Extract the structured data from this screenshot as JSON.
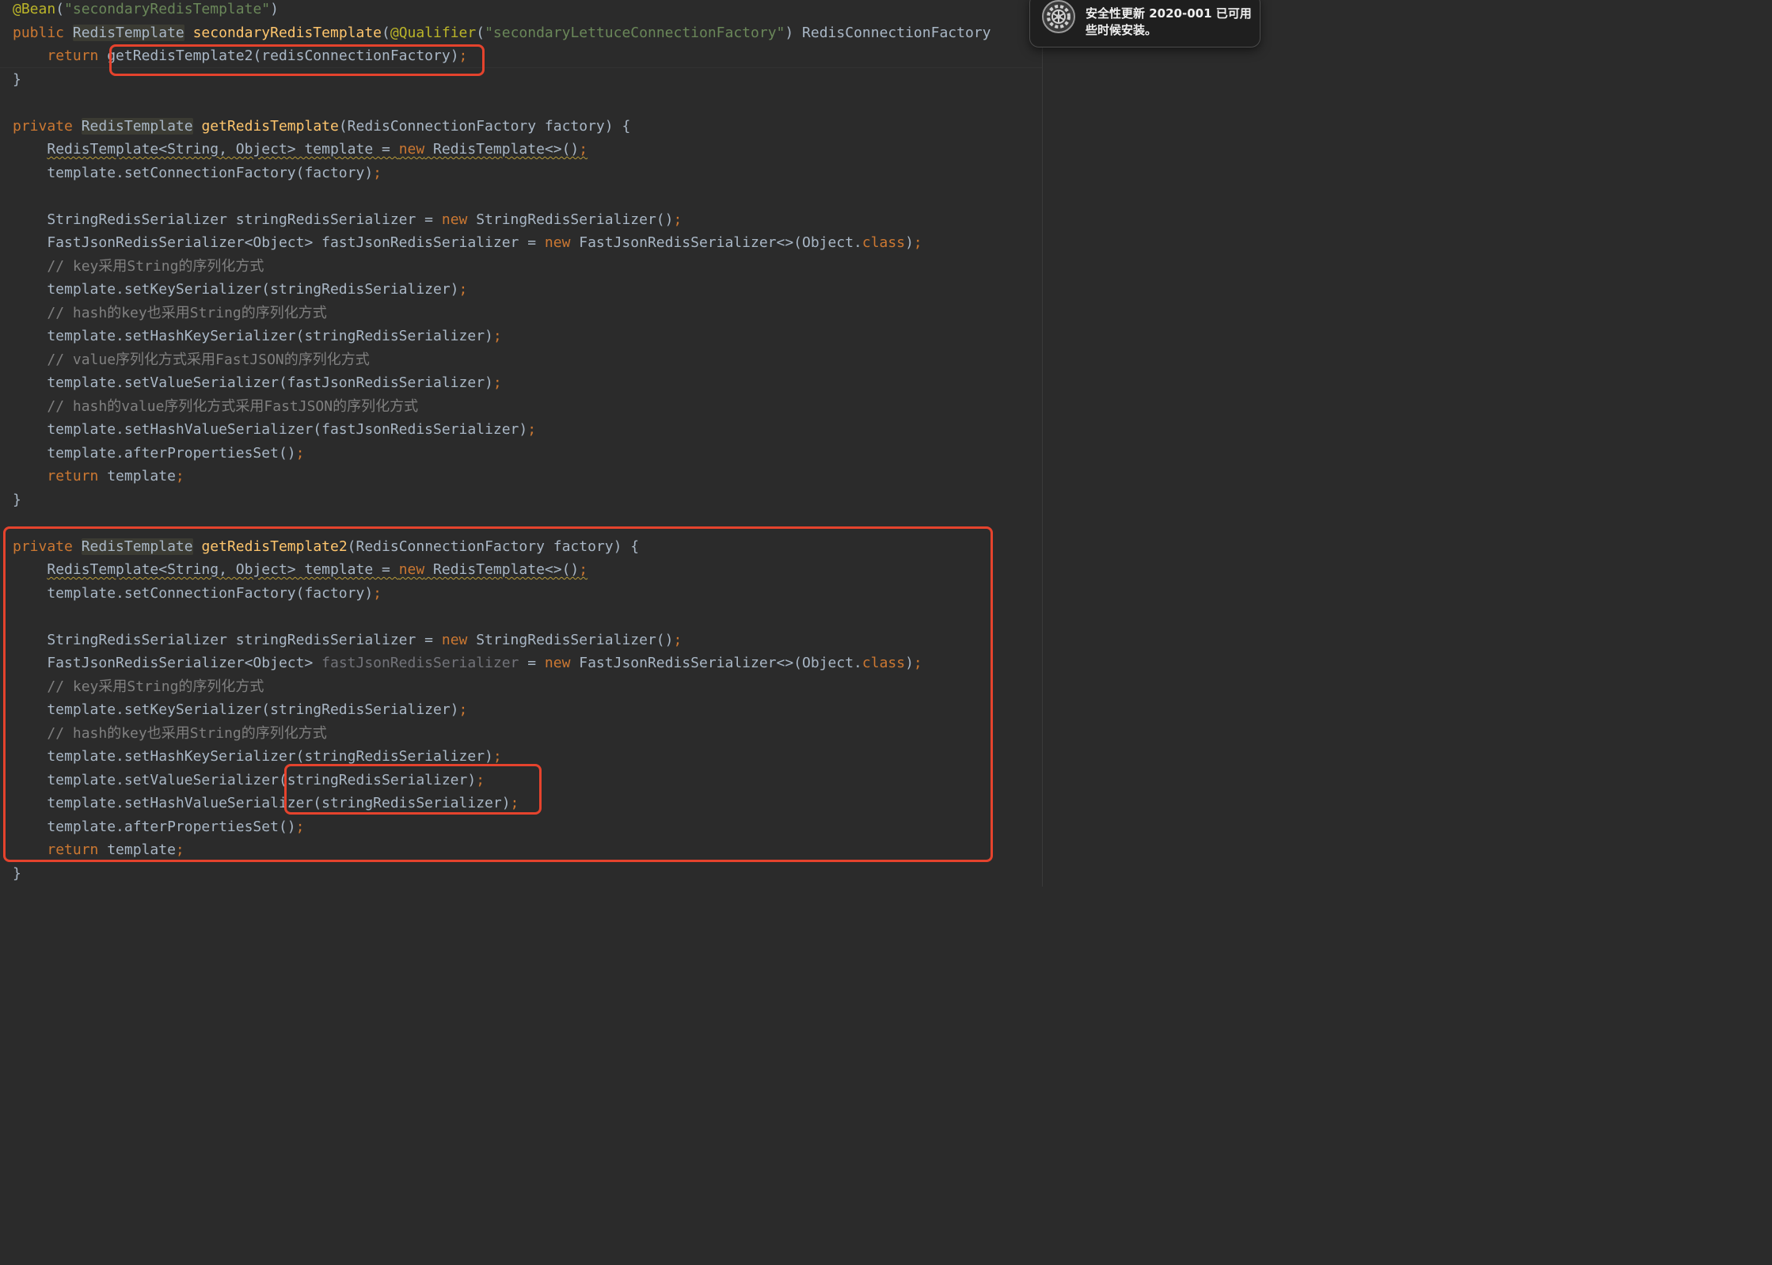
{
  "editor": {
    "lines": [
      [
        {
          "c": "ann",
          "t": "@Bean"
        },
        {
          "t": "("
        },
        {
          "c": "str",
          "t": "\"secondaryRedisTemplate\""
        },
        {
          "t": ")"
        }
      ],
      [
        {
          "c": "kw",
          "t": "public "
        },
        {
          "c": "hl-type",
          "t": "RedisTemplate"
        },
        {
          "t": " "
        },
        {
          "c": "fn",
          "t": "secondaryRedisTemplate"
        },
        {
          "t": "("
        },
        {
          "c": "ann",
          "t": "@Qualifier"
        },
        {
          "t": "("
        },
        {
          "c": "str",
          "t": "\"secondaryLettuceConnectionFactory\""
        },
        {
          "t": ") RedisConnectionFactory"
        }
      ],
      [
        {
          "t": "    "
        },
        {
          "c": "kw",
          "t": "return "
        },
        {
          "t": "getRedisTemplate2(redisConnectionFactory)"
        },
        {
          "c": "kw",
          "t": ";"
        }
      ],
      [
        {
          "t": "}"
        }
      ],
      [],
      [
        {
          "c": "kw",
          "t": "private "
        },
        {
          "c": "hl-type",
          "t": "RedisTemplate"
        },
        {
          "t": " "
        },
        {
          "c": "fn",
          "t": "getRedisTemplate"
        },
        {
          "t": "(RedisConnectionFactory factory) {"
        }
      ],
      [
        {
          "t": "    "
        },
        {
          "c": "warn",
          "t": "RedisTemplate<String, Object> template = "
        },
        {
          "c": "kw warn",
          "t": "new"
        },
        {
          "c": "warn",
          "t": " RedisTemplate<>()"
        },
        {
          "c": "kw warn",
          "t": ";"
        }
      ],
      [
        {
          "t": "    template.setConnectionFactory(factory)"
        },
        {
          "c": "kw",
          "t": ";"
        }
      ],
      [],
      [
        {
          "t": "    StringRedisSerializer stringRedisSerializer = "
        },
        {
          "c": "kw",
          "t": "new"
        },
        {
          "t": " StringRedisSerializer()"
        },
        {
          "c": "kw",
          "t": ";"
        }
      ],
      [
        {
          "t": "    FastJsonRedisSerializer<Object> fastJsonRedisSerializer = "
        },
        {
          "c": "kw",
          "t": "new"
        },
        {
          "t": " FastJsonRedisSerializer<>(Object."
        },
        {
          "c": "kw",
          "t": "class"
        },
        {
          "t": ")"
        },
        {
          "c": "kw",
          "t": ";"
        }
      ],
      [
        {
          "t": "    "
        },
        {
          "c": "cm",
          "t": "// key采用String的序列化方式"
        }
      ],
      [
        {
          "t": "    template.setKeySerializer(stringRedisSerializer)"
        },
        {
          "c": "kw",
          "t": ";"
        }
      ],
      [
        {
          "t": "    "
        },
        {
          "c": "cm",
          "t": "// hash的key也采用String的序列化方式"
        }
      ],
      [
        {
          "t": "    template.setHashKeySerializer(stringRedisSerializer)"
        },
        {
          "c": "kw",
          "t": ";"
        }
      ],
      [
        {
          "t": "    "
        },
        {
          "c": "cm",
          "t": "// value序列化方式采用FastJSON的序列化方式"
        }
      ],
      [
        {
          "t": "    template.setValueSerializer(fastJsonRedisSerializer)"
        },
        {
          "c": "kw",
          "t": ";"
        }
      ],
      [
        {
          "t": "    "
        },
        {
          "c": "cm",
          "t": "// hash的value序列化方式采用FastJSON的序列化方式"
        }
      ],
      [
        {
          "t": "    template.setHashValueSerializer(fastJsonRedisSerializer)"
        },
        {
          "c": "kw",
          "t": ";"
        }
      ],
      [
        {
          "t": "    template.afterPropertiesSet()"
        },
        {
          "c": "kw",
          "t": ";"
        }
      ],
      [
        {
          "t": "    "
        },
        {
          "c": "kw",
          "t": "return "
        },
        {
          "t": "template"
        },
        {
          "c": "kw",
          "t": ";"
        }
      ],
      [
        {
          "t": "}"
        }
      ],
      [],
      [
        {
          "c": "kw",
          "t": "private "
        },
        {
          "c": "hl-type",
          "t": "RedisTemplate"
        },
        {
          "t": " "
        },
        {
          "c": "fn",
          "t": "getRedisTemplate2"
        },
        {
          "t": "(RedisConnectionFactory factory) {"
        }
      ],
      [
        {
          "t": "    "
        },
        {
          "c": "warn",
          "t": "RedisTemplate<String, Object> template = "
        },
        {
          "c": "kw warn",
          "t": "new"
        },
        {
          "c": "warn",
          "t": " RedisTemplate<>()"
        },
        {
          "c": "kw warn",
          "t": ";"
        }
      ],
      [
        {
          "t": "    template.setConnectionFactory(factory)"
        },
        {
          "c": "kw",
          "t": ";"
        }
      ],
      [],
      [
        {
          "t": "    StringRedisSerializer stringRedisSerializer = "
        },
        {
          "c": "kw",
          "t": "new"
        },
        {
          "t": " StringRedisSerializer()"
        },
        {
          "c": "kw",
          "t": ";"
        }
      ],
      [
        {
          "t": "    FastJsonRedisSerializer<Object> "
        },
        {
          "c": "muted",
          "t": "fastJsonRedisSerializer"
        },
        {
          "t": " = "
        },
        {
          "c": "kw",
          "t": "new"
        },
        {
          "t": " FastJsonRedisSerializer<>(Object."
        },
        {
          "c": "kw",
          "t": "class"
        },
        {
          "t": ")"
        },
        {
          "c": "kw",
          "t": ";"
        }
      ],
      [
        {
          "t": "    "
        },
        {
          "c": "cm",
          "t": "// key采用String的序列化方式"
        }
      ],
      [
        {
          "t": "    template.setKeySerializer(stringRedisSerializer)"
        },
        {
          "c": "kw",
          "t": ";"
        }
      ],
      [
        {
          "t": "    "
        },
        {
          "c": "cm",
          "t": "// hash的key也采用String的序列化方式"
        }
      ],
      [
        {
          "t": "    template.setHashKeySerializer(stringRedisSerializer)"
        },
        {
          "c": "kw",
          "t": ";"
        }
      ],
      [
        {
          "t": "    template.setValueSerializer(stringRedisSerializer)"
        },
        {
          "c": "kw",
          "t": ";"
        }
      ],
      [
        {
          "t": "    template.setHashValueSerializer(stringRedisSerializer)"
        },
        {
          "c": "kw",
          "t": ";"
        }
      ],
      [
        {
          "t": "    template.afterPropertiesSet()"
        },
        {
          "c": "kw",
          "t": ";"
        }
      ],
      [
        {
          "t": "    "
        },
        {
          "c": "kw",
          "t": "return "
        },
        {
          "t": "template"
        },
        {
          "c": "kw",
          "t": ";"
        }
      ],
      [
        {
          "t": "}"
        }
      ]
    ]
  },
  "notification": {
    "icon": "gear-icon",
    "text": "安全性更新 2020-001 已可用\n些时候安装。"
  },
  "colors": {
    "background": "#2b2b2b",
    "keyword": "#cc7832",
    "annotation": "#bbb529",
    "string": "#6a8759",
    "method": "#ffc66d",
    "comment": "#808080",
    "text": "#a9b7c6",
    "annotation_box": "#e5432d"
  }
}
